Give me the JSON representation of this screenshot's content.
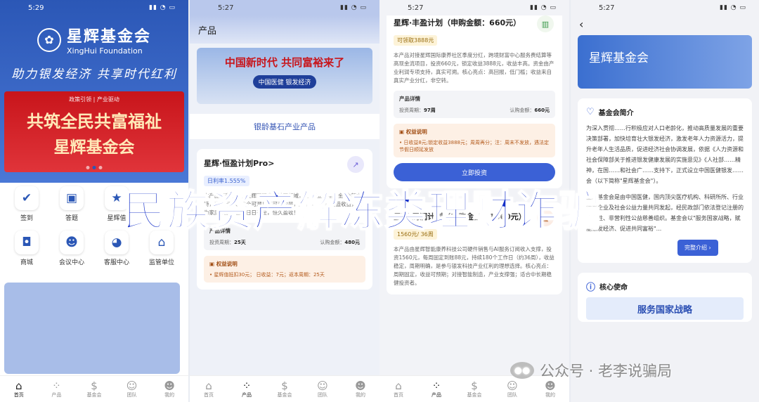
{
  "s1": {
    "time": "5:29",
    "logo_cn": "星辉基金会",
    "logo_en": "XingHui Foundation",
    "slogan": "助力银发经济  共享时代红利",
    "banner_tag": "政策引领 | 产业驱动",
    "banner_line1": "共筑全民共富福祉",
    "banner_line2": "星辉基金会",
    "grid": [
      {
        "label": "签到",
        "icon": "calendar-icon",
        "glyph": "✔"
      },
      {
        "label": "答题",
        "icon": "quiz-icon",
        "glyph": "▣"
      },
      {
        "label": "星辉值",
        "icon": "star-icon",
        "glyph": "★"
      },
      {
        "label": "",
        "icon": "blank",
        "glyph": ""
      },
      {
        "label": "商城",
        "icon": "shopping-bag-icon",
        "glyph": "◘"
      },
      {
        "label": "会议中心",
        "icon": "people-icon",
        "glyph": "☻"
      },
      {
        "label": "客服中心",
        "icon": "headset-icon",
        "glyph": "◕"
      },
      {
        "label": "监管单位",
        "icon": "building-icon",
        "glyph": "⌂"
      }
    ]
  },
  "nav": [
    "首页",
    "产品",
    "基金会",
    "团队",
    "我的"
  ],
  "s2": {
    "time": "5:27",
    "header": "产品",
    "banner_text": "中国新时代  共同富裕来了",
    "banner_badge": "中国医健 银发经济",
    "category": "银龄基石产业产品",
    "card_title": "星辉·恒盈计划Pro>",
    "rate": "日利率1.555%",
    "desc": "本产品红利来源于星辉国际康养社区领域，由\"产业反哺基金\"全额支持，资金闭环、安全可溯！更可贵的是，您不仅为自己创造收益，更为家庭积累价值！日日有金，恒久盈收！",
    "detail_title": "产品详情",
    "period_label": "投资周期：",
    "period": "25天",
    "amount_label": "认购金额：",
    "amount": "480元",
    "rights_title": "权益说明",
    "rights": "• 星辉值抵扣30元； 日收益：7元；返本周期：25天"
  },
  "s3": {
    "time": "5:27",
    "card1_title": "星辉·丰盈计划（申购金额：660元）",
    "card1_pill": "可领取3888元",
    "card1_desc": "本产品对接星辉国际康养社区季度分红，跨境财富中心服务费结算等高现金流项目，投资660元，锁定收益3888元，收益丰高。资金由产业利润专项支持，真实可溯。核心亮点：高回报，低门槛；收益来自真实产业分红，非空转。",
    "detail_title": "产品详情",
    "period_label": "投资周期：",
    "period": "97周",
    "amount_label": "认购金额：",
    "amount": "660元",
    "rights_title": "权益说明",
    "rights": "• 日收益8元;锁定收益3888元；周周再分；注：周末不发放，遇法定节假日顺延发放",
    "invest_btn": "立即投资",
    "card2_title": "星辉·周润计划（申购金额：1560元）",
    "card2_pill": "1560元/ 36周",
    "card2_desc": "本产品由星辉智能康养科技公司硬件销售与AI服务订阅收入支撑，投资1560元，每周固定到账88元，持续180个工作日（约36周），收益稳定，周期明确，是参与银发科技产业红利的理想选择。核心亮点：周期固定，收益可预期；对接智能制造，产业支撑强；适合中长期稳健投资者。"
  },
  "s4": {
    "time": "5:27",
    "banner": "星辉基金会",
    "intro_title": "基金会简介",
    "intro_p1": "为深入贯彻……行积极应对人口老龄化，推动高质量发展的重要决策部署，加快培育壮大银发经济，激发老年人力资源活力，提升老年人生活品质，促进经济社会协调发展，依据《人力资源和社会保障部关于推进银发健康发展的实施意见》《人社部……精神，在国……和社会广……支持下，正式设立中国医健银发……会（以下简称\"星辉基金会\"）。",
    "intro_p2": "星辉基金会是由中国医健，国内顶尖医疗机构、科研所所、行业领军企业及社会公益力量共同发起，经民政部门依法登记注册的全国性、非营利性公益慈善组织。基金会以\"服务国家战略，赋能银发经济、促进共同富裕\"...",
    "more_btn": "完整介绍 ›",
    "mission_title": "核心使命",
    "mission_sub": "服务国家战略"
  },
  "overlay_text": "民族资产解冻类理财诈骗",
  "watermark": "公众号 · 老李说骗局"
}
